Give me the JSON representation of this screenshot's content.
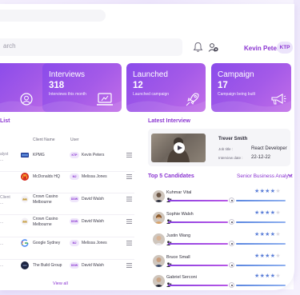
{
  "header": {
    "search_placeholder": "arch",
    "user_name": "Kevin Peters",
    "user_initials": "KTP"
  },
  "stats": [
    {
      "title": "Interviews",
      "value": "318",
      "subtitle": "Interviews this month",
      "icon": "monitor-icon"
    },
    {
      "title": "Launched",
      "value": "12",
      "subtitle": "Launched campaign",
      "icon": "rocket-icon"
    },
    {
      "title": "Campaign",
      "value": "17",
      "subtitle": "Campaign being built",
      "icon": "megaphone-icon"
    }
  ],
  "client_list": {
    "title": "List",
    "headers": {
      "client": "Client Name",
      "user": "User"
    },
    "rows": [
      {
        "left_fragment": "alyst\n...",
        "client": "KPMG",
        "initials": "KTP",
        "user": "Kevin Peters"
      },
      {
        "left_fragment": "",
        "client": "McDonalds HQ",
        "initials": "MJ",
        "user": "Melissa Jones"
      },
      {
        "left_fragment": "Client\n...",
        "client": "Crown Casino\nMelbourne",
        "initials": "DDW",
        "user": "David Walsh"
      },
      {
        "left_fragment": "...",
        "client": "Crown Casino\nMelbourne",
        "initials": "DDW",
        "user": "David Walsh"
      },
      {
        "left_fragment": "...",
        "client": "Google Sydney",
        "initials": "MJ",
        "user": "Melissa Jones"
      },
      {
        "left_fragment": "...",
        "client": "The Build Group",
        "initials": "DDW",
        "user": "David Walsh"
      }
    ],
    "view_all": "View all"
  },
  "latest_interview": {
    "title": "Latest Interview",
    "name": "Trever Smith",
    "job_title_label": "Job title :",
    "job_title": "React Developer",
    "date_label": "Interview date :",
    "date": "22-12-22"
  },
  "candidates": {
    "title": "Top 5 Candidates",
    "filter": "Senior Business Analyst",
    "items": [
      {
        "name": "Kuhmar Vital",
        "rating": 4
      },
      {
        "name": "Sophie Walsh",
        "rating": 4
      },
      {
        "name": "Justin Wang",
        "rating": 4
      },
      {
        "name": "Bruce Small",
        "rating": 4
      },
      {
        "name": "Gabriel Serconi",
        "rating": 4
      }
    ]
  },
  "colors": {
    "accent": "#8a34d1",
    "card_gradient_start": "#8a4bea",
    "card_gradient_end": "#c26ee8",
    "star": "#5c7fd8"
  }
}
